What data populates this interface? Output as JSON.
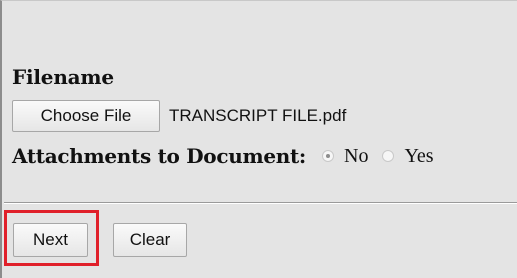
{
  "form": {
    "filename_label": "Filename",
    "choose_file_label": "Choose File",
    "selected_file": "TRANSCRIPT FILE.pdf",
    "attachments_label": "Attachments to Document:",
    "attachments_options": [
      {
        "label": "No",
        "selected": true
      },
      {
        "label": "Yes",
        "selected": false
      }
    ]
  },
  "actions": {
    "next_label": "Next",
    "clear_label": "Clear",
    "highlight_color": "#e0202a"
  }
}
